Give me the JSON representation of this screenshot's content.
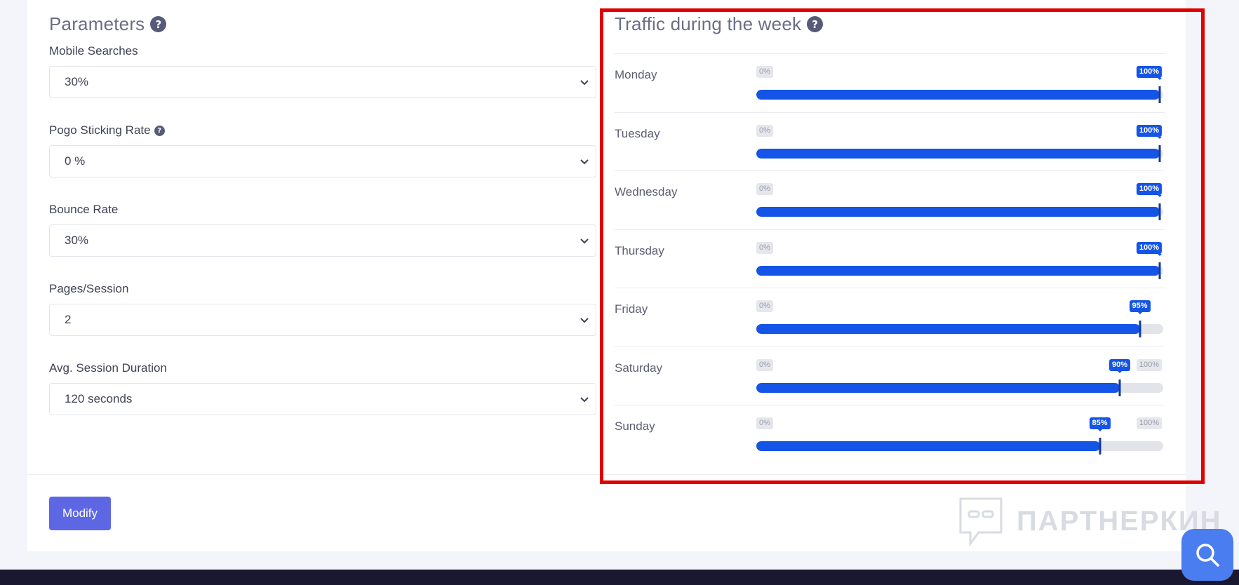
{
  "parameters": {
    "title": "Parameters",
    "fields": [
      {
        "label": "Mobile Searches",
        "value": "30%",
        "has_help": false
      },
      {
        "label": "Pogo Sticking Rate",
        "value": "0 %",
        "has_help": true
      },
      {
        "label": "Bounce Rate",
        "value": "30%",
        "has_help": false
      },
      {
        "label": "Pages/Session",
        "value": "2",
        "has_help": false
      },
      {
        "label": "Avg. Session Duration",
        "value": "120 seconds",
        "has_help": false
      }
    ],
    "modify_label": "Modify"
  },
  "traffic": {
    "title": "Traffic during the week",
    "min_label": "0%",
    "max_label": "100%",
    "days": [
      {
        "day": "Monday",
        "value": 100,
        "value_label": "100%"
      },
      {
        "day": "Tuesday",
        "value": 100,
        "value_label": "100%"
      },
      {
        "day": "Wednesday",
        "value": 100,
        "value_label": "100%"
      },
      {
        "day": "Thursday",
        "value": 100,
        "value_label": "100%"
      },
      {
        "day": "Friday",
        "value": 95,
        "value_label": "95%"
      },
      {
        "day": "Saturday",
        "value": 90,
        "value_label": "90%"
      },
      {
        "day": "Sunday",
        "value": 85,
        "value_label": "85%"
      }
    ]
  },
  "watermark": {
    "text": "ПАРТНЕРКИН"
  },
  "colors": {
    "accent": "#1454e6",
    "button": "#5d67e3",
    "highlight": "#e00000",
    "fab": "#4a7df0"
  },
  "icons": [
    "help-icon",
    "chevron-down-icon",
    "search-icon",
    "watermark-logo-icon"
  ]
}
